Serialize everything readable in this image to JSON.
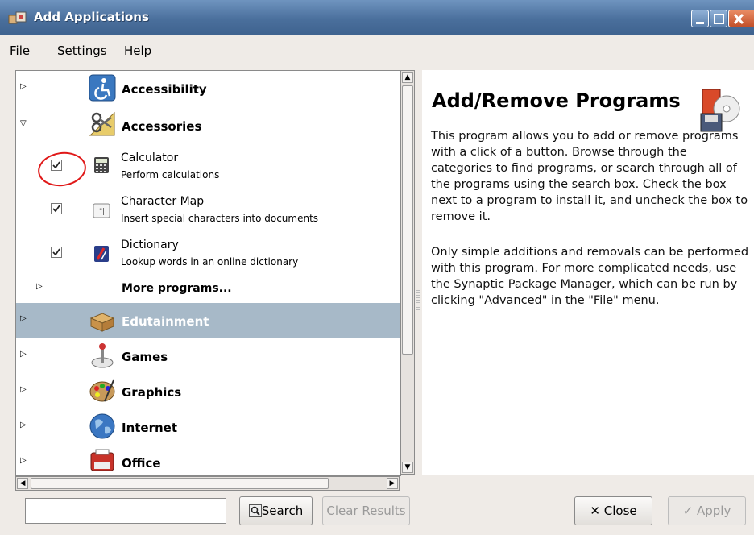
{
  "window": {
    "title": "Add Applications"
  },
  "menu": [
    {
      "label": "File",
      "mnemonic": "F",
      "rest": "ile"
    },
    {
      "label": "Settings",
      "mnemonic": "S",
      "rest": "ettings"
    },
    {
      "label": "Help",
      "mnemonic": "H",
      "rest": "elp"
    }
  ],
  "tree": {
    "categories": [
      {
        "label": "Accessibility",
        "expanded": false,
        "icon": "accessibility-icon"
      },
      {
        "label": "Accessories",
        "expanded": true,
        "icon": "accessories-icon"
      },
      {
        "label": "Edutainment",
        "expanded": false,
        "icon": "edutainment-icon",
        "selected": true
      },
      {
        "label": "Games",
        "expanded": false,
        "icon": "games-icon"
      },
      {
        "label": "Graphics",
        "expanded": false,
        "icon": "graphics-icon"
      },
      {
        "label": "Internet",
        "expanded": false,
        "icon": "internet-icon"
      },
      {
        "label": "Office",
        "expanded": false,
        "icon": "office-icon"
      }
    ],
    "programs": [
      {
        "name": "Calculator",
        "description": "Perform calculations",
        "checked": true,
        "icon": "calculator-icon"
      },
      {
        "name": "Character Map",
        "description": "Insert special characters into documents",
        "checked": true,
        "icon": "character-map-icon"
      },
      {
        "name": "Dictionary",
        "description": "Lookup words in an online dictionary",
        "checked": true,
        "icon": "dictionary-icon"
      }
    ],
    "more_programs": "More programs..."
  },
  "info": {
    "title": "Add/Remove Programs",
    "p1": "This program allows you to add or remove programs with a click of a button. Browse through the categories to find programs, or search through all of the programs using the search box. Check the box next to a program to install it, and uncheck the box to remove it.",
    "p2": "Only simple additions and removals can be performed with this program. For more complicated needs, use the Synaptic Package Manager, which can be run by clicking \"Advanced\" in the \"File\" menu."
  },
  "search": {
    "value": "",
    "placeholder": ""
  },
  "buttons": {
    "search": {
      "label": "Search",
      "mnemonic": "S",
      "rest": "earch"
    },
    "clear_results": "Clear Results",
    "close": {
      "label": "Close",
      "mnemonic": "C",
      "rest": "lose"
    },
    "apply": {
      "label": "Apply",
      "mnemonic": "A",
      "rest": "pply"
    }
  },
  "colors": {
    "selection": "#a7b9c8",
    "titlebar": "#4a6f9c",
    "annotation": "#e01818"
  }
}
